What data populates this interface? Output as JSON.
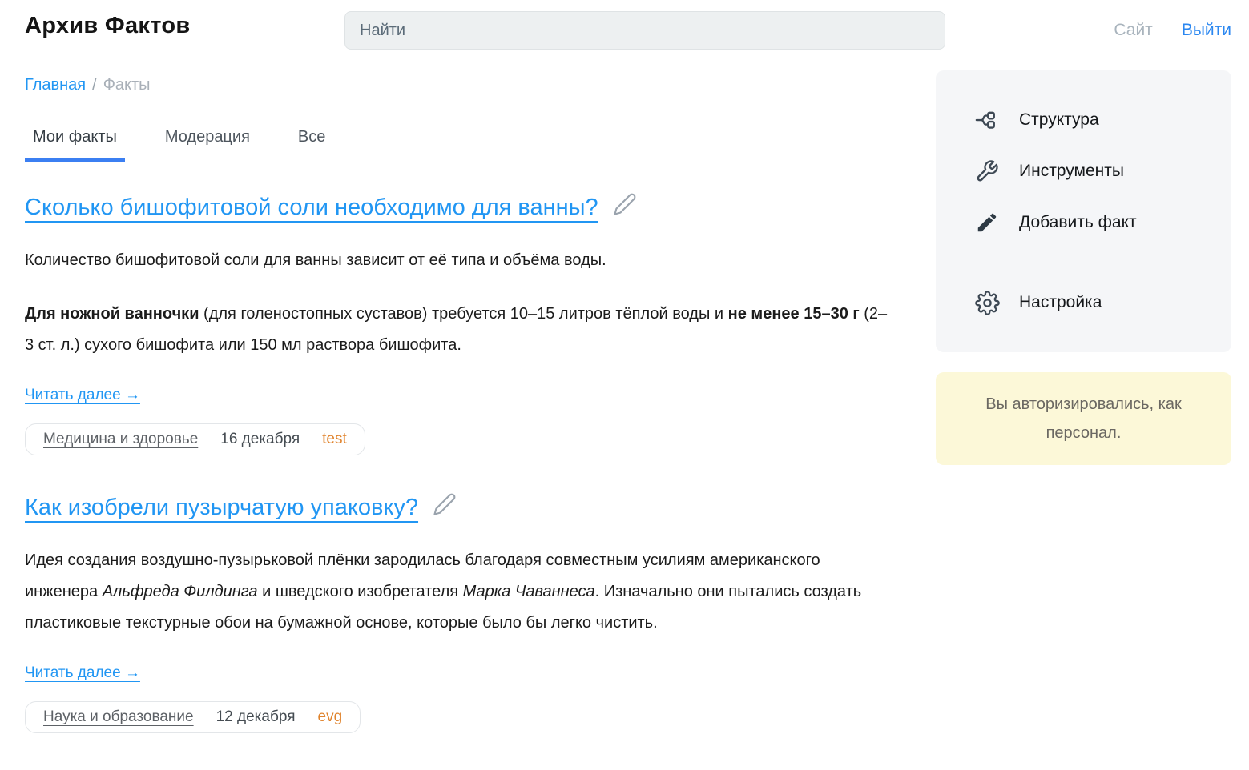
{
  "header": {
    "site_title": "Архив Фактов",
    "search_placeholder": "Найти",
    "site_link": "Сайт",
    "logout_link": "Выйти"
  },
  "breadcrumb": {
    "home": "Главная",
    "separator": "/",
    "current": "Факты"
  },
  "tabs": [
    {
      "id": "my-facts",
      "label": "Мои факты",
      "active": true
    },
    {
      "id": "moderation",
      "label": "Модерация",
      "active": false
    },
    {
      "id": "all",
      "label": "Все",
      "active": false
    }
  ],
  "articles": [
    {
      "title": "Сколько бишофитовой соли необходимо для ванны?",
      "paragraphs": [
        [
          {
            "text": "Количество бишофитовой соли для ванны зависит от её типа и объёма воды.",
            "style": "normal"
          }
        ],
        [
          {
            "text": "Для ножной ванночки",
            "style": "bold"
          },
          {
            "text": " (для голеностопных суставов) требуется 10–15 литров тёплой воды и ",
            "style": "normal"
          },
          {
            "text": "не менее 15–30 г",
            "style": "bold"
          },
          {
            "text": " (2–3 ст. л.) сухого бишофита или 150 мл раствора бишофита.",
            "style": "normal"
          }
        ]
      ],
      "read_more": "Читать далее →",
      "meta": {
        "category": "Медицина и здоровье",
        "date": "16 декабря",
        "author": "test"
      }
    },
    {
      "title": "Как изобрели пузырчатую упаковку?",
      "paragraphs": [
        [
          {
            "text": "Идея создания воздушно-пузырьковой плёнки зародилась благодаря совместным усилиям американского инженера ",
            "style": "normal"
          },
          {
            "text": "Альфреда Филдинга",
            "style": "italic"
          },
          {
            "text": " и шведского изобретателя ",
            "style": "normal"
          },
          {
            "text": "Марка Чаваннеса",
            "style": "italic"
          },
          {
            "text": ". Изначально они пытались создать пластиковые текстурные обои на бумажной основе, которые было бы легко чистить.",
            "style": "normal"
          }
        ]
      ],
      "read_more": "Читать далее →",
      "meta": {
        "category": "Наука и образование",
        "date": "12 декабря",
        "author": "evg"
      }
    }
  ],
  "sidebar": {
    "items": [
      {
        "id": "structure",
        "icon": "structure-icon",
        "label": "Структура",
        "separated": false
      },
      {
        "id": "tools",
        "icon": "wrench-icon",
        "label": "Инструменты",
        "separated": false
      },
      {
        "id": "add-fact",
        "icon": "pencil-icon",
        "label": "Добавить факт",
        "separated": false
      },
      {
        "id": "settings",
        "icon": "gear-icon",
        "label": "Настройка",
        "separated": true
      }
    ],
    "notice": "Вы авторизировались, как персонал."
  },
  "colors": {
    "link_blue": "#2196f3",
    "tab_underline": "#3b7ff2",
    "author_orange": "#e0832c",
    "sidebar_bg": "#f5f6f8",
    "notice_bg": "#fcf8d8",
    "search_bg": "#edf0f1"
  }
}
